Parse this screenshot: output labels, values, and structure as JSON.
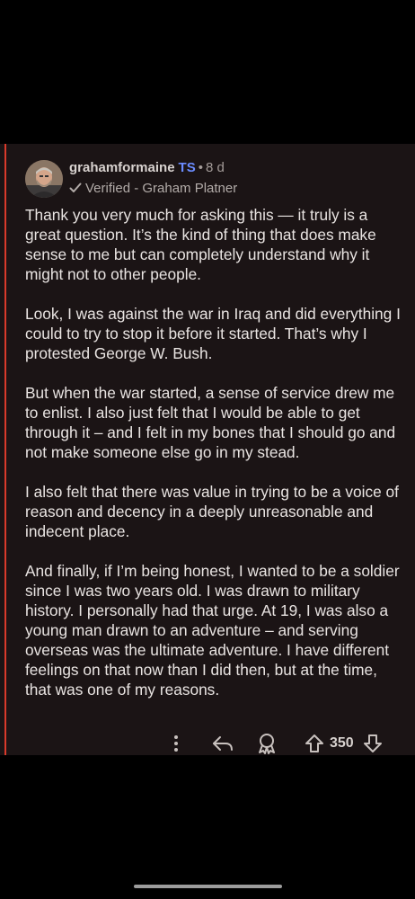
{
  "comment": {
    "username": "grahamformaine",
    "badge": "TS",
    "separator": "•",
    "age": "8 d",
    "verified": "Verified - Graham Platner",
    "paragraphs": [
      "Thank you very much for asking this — it truly is a great question. It’s the kind of thing that does make sense to me but can completely understand why it might not to other people.",
      "Look, I was against the war in Iraq and did everything I could to try to stop it before it started. That’s why I protested George W. Bush.",
      "But when the war started, a sense of service drew me to enlist. I also just felt that I would be able to get through it – and I felt in my bones that I should go and not make someone else go in my stead.",
      "I also felt that there was value in trying to be a voice of reason and decency in a deeply unreasonable and indecent place.",
      "And finally, if I’m being honest, I wanted to be a soldier since I was two years old. I was drawn to military history. I personally had that urge. At 19, I was also a young man drawn to an adventure – and serving overseas was the ultimate adventure. I have different feelings on that now than I did then, but at the time, that was one of my reasons."
    ],
    "vote_count": "350"
  },
  "icons": {
    "verified": "check-icon",
    "more": "more-vertical-icon",
    "reply": "reply-icon",
    "award": "award-icon",
    "upvote": "upvote-icon",
    "downvote": "downvote-icon"
  },
  "colors": {
    "thread_line": "#d93a2b",
    "badge": "#6b8cff",
    "background": "#1b1415"
  }
}
